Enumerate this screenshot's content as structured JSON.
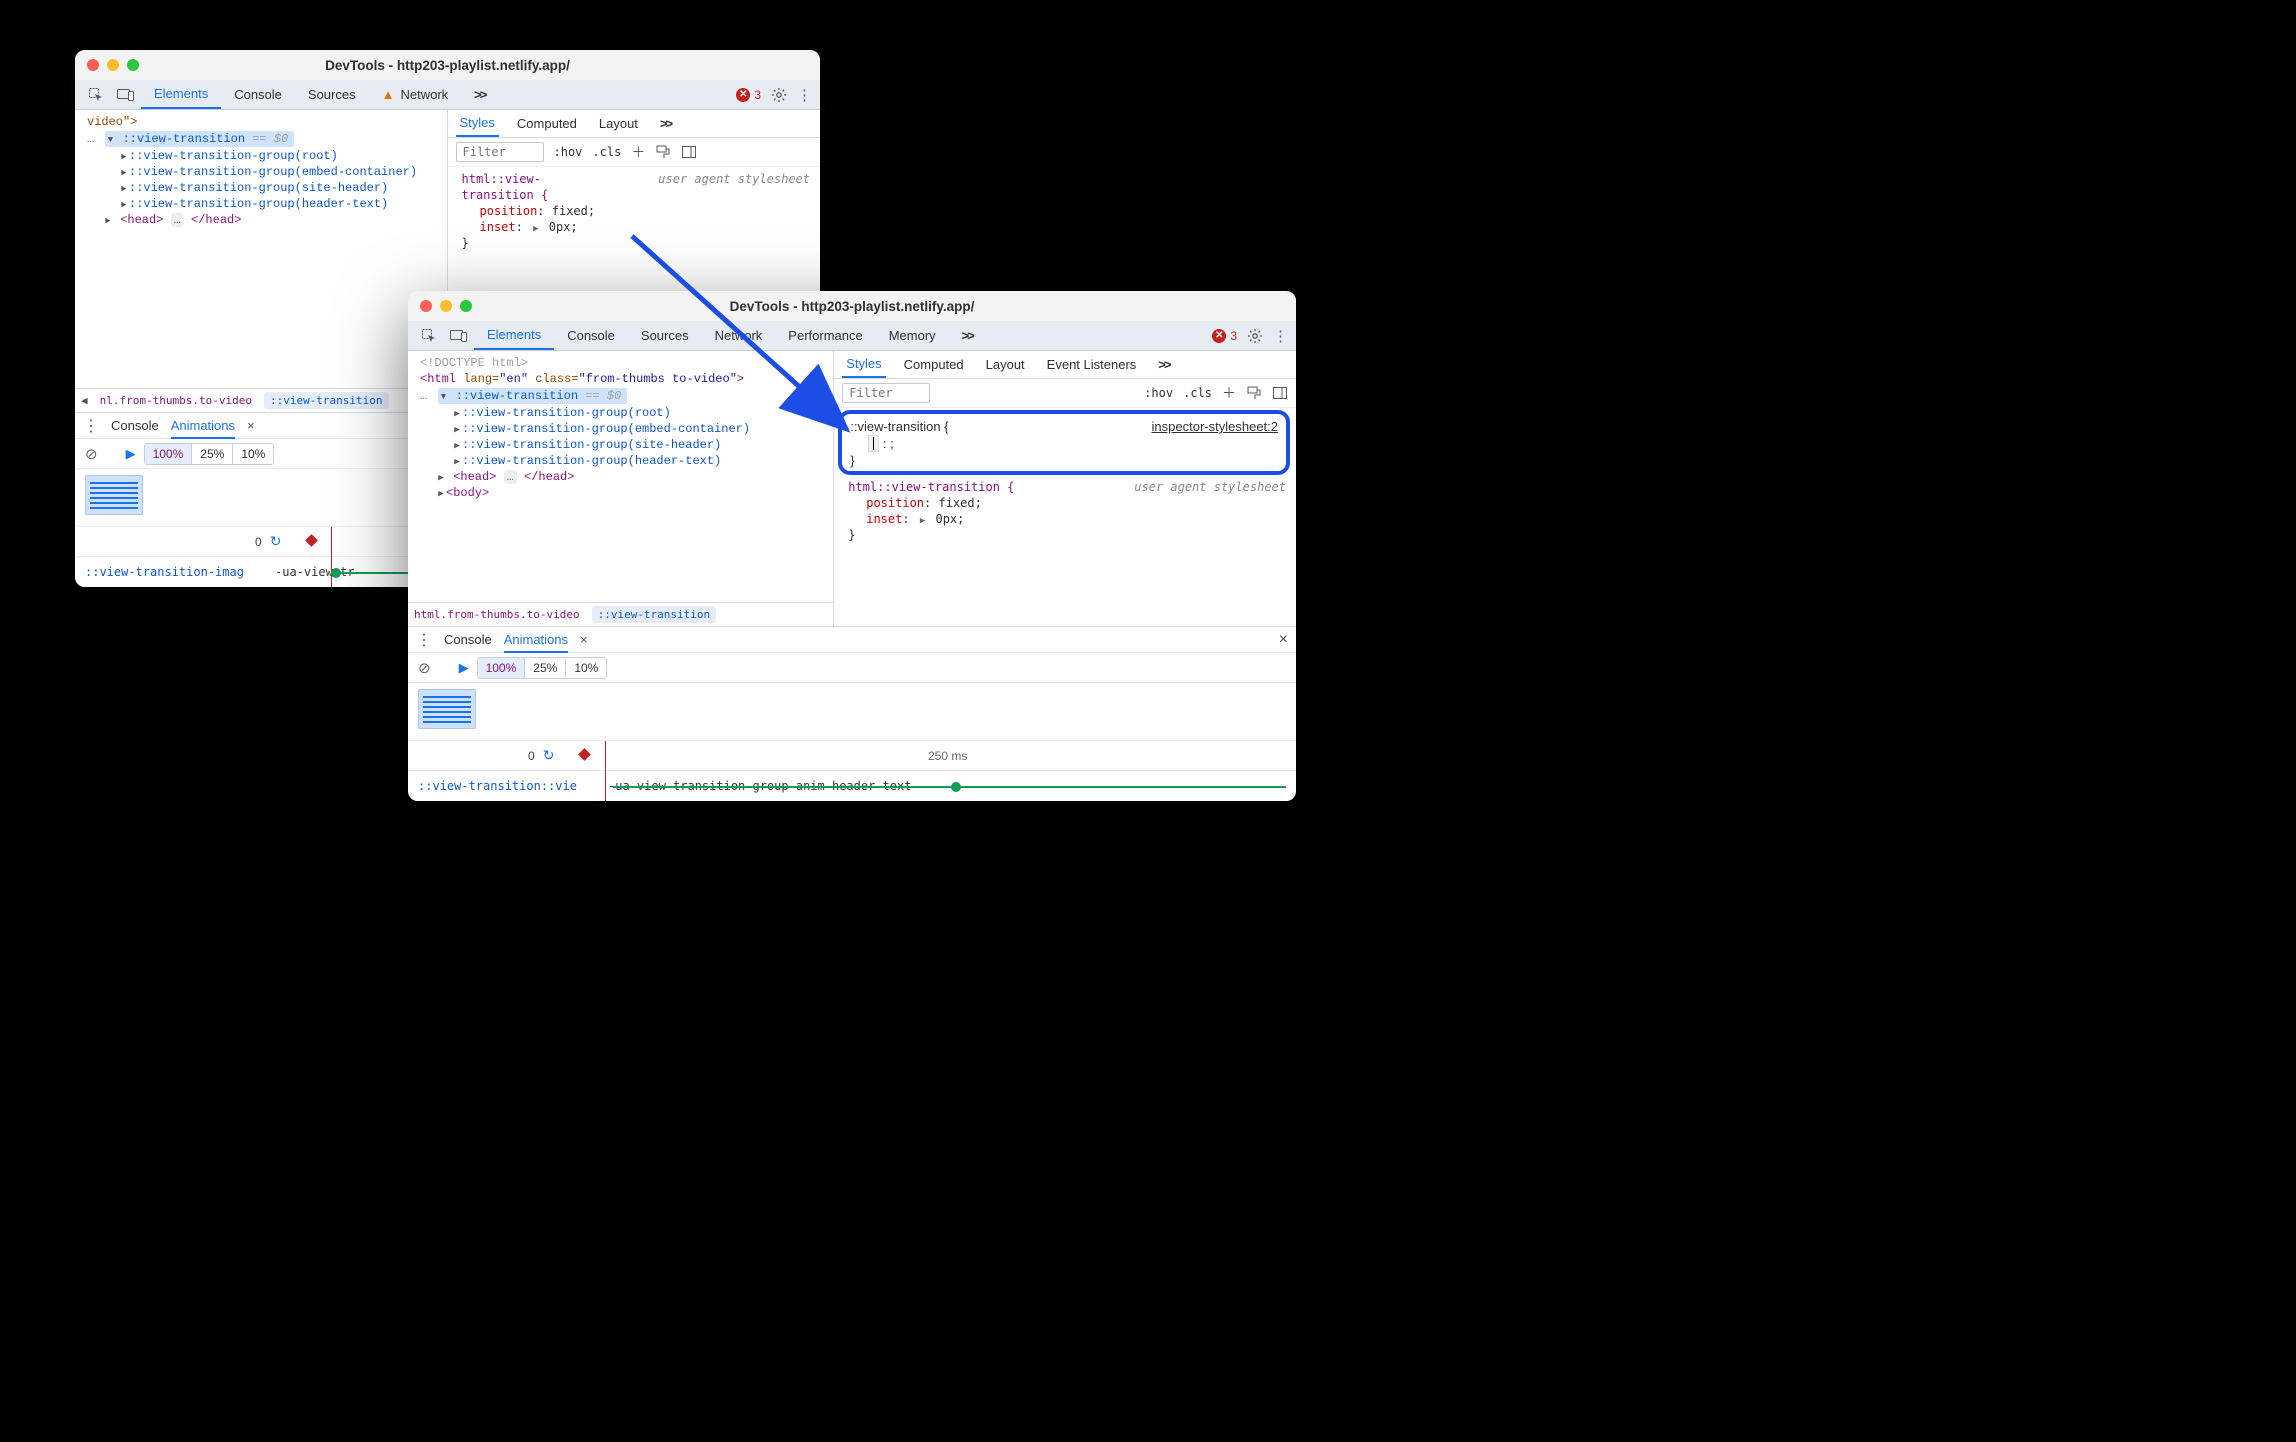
{
  "common": {
    "title_prefix": "DevTools - ",
    "url": "http203-playlist.netlify.app/",
    "error_count": "3",
    "chevrons": ">>",
    "hov_label": ":hov",
    "cls_label": ".cls",
    "filter_placeholder": "Filter"
  },
  "tabs_small": {
    "elements": "Elements",
    "console": "Console",
    "sources": "Sources",
    "network": "Network"
  },
  "tabs_large": {
    "elements": "Elements",
    "console": "Console",
    "sources": "Sources",
    "network": "Network",
    "performance": "Performance",
    "memory": "Memory"
  },
  "styles_tabs": {
    "styles": "Styles",
    "computed": "Computed",
    "layout": "Layout",
    "event_listeners": "Event Listeners"
  },
  "drawer": {
    "console": "Console",
    "animations": "Animations",
    "close_x": "×"
  },
  "speed": {
    "s100": "100%",
    "s25": "25%",
    "s10": "10%"
  },
  "small": {
    "dom": {
      "line0_partial": "video\">",
      "sel": "::view-transition",
      "ref": "== $0",
      "g_root": "::view-transition-group(root)",
      "g_embed": "::view-transition-group(embed-container)",
      "g_site": "::view-transition-group(site-header)",
      "g_header": "::view-transition-group(header-text)",
      "head_open": "<head>",
      "head_dots": "…",
      "head_close": "</head>"
    },
    "crumbs": {
      "a": "nl.from-thumbs.to-video",
      "b": "::view-transition"
    },
    "styles": {
      "source": "user agent stylesheet",
      "selector_l1": "html::view-",
      "selector_l2": "transition {",
      "p_position": "position",
      "v_position": "fixed",
      "p_inset": "inset",
      "v_inset": "0px",
      "close": "}"
    },
    "anim": {
      "zero": "0",
      "track_a": "::view-transition-imag",
      "track_b": "-ua-view-tr"
    }
  },
  "large": {
    "dom": {
      "doctype": "<!DOCTYPE html>",
      "html_open": "<html lang=\"en\" class=\"from-thumbs to-video\">",
      "sel": "::view-transition",
      "ref": "== $0",
      "g_root": "::view-transition-group(root)",
      "g_embed": "::view-transition-group(embed-container)",
      "g_site": "::view-transition-group(site-header)",
      "g_header": "::view-transition-group(header-text)",
      "head_open": "<head>",
      "head_dots": "…",
      "head_close": "</head>",
      "body_open": "<body>"
    },
    "crumbs": {
      "a": "html.from-thumbs.to-video",
      "b": "::view-transition"
    },
    "styles": {
      "new_selector": "::view-transition {",
      "new_source": "inspector-stylesheet:2",
      "new_body": ":  ;",
      "new_close": "}",
      "ua_source": "user agent stylesheet",
      "ua_selector": "html::view-transition {",
      "p_position": "position",
      "v_position": "fixed",
      "p_inset": "inset",
      "v_inset": "0px",
      "close": "}"
    },
    "anim": {
      "zero": "0",
      "t_250": "250 ms",
      "track_a": "::view-transition::vie",
      "track_b": "-ua-view-transition-group-anim-header-text"
    }
  }
}
